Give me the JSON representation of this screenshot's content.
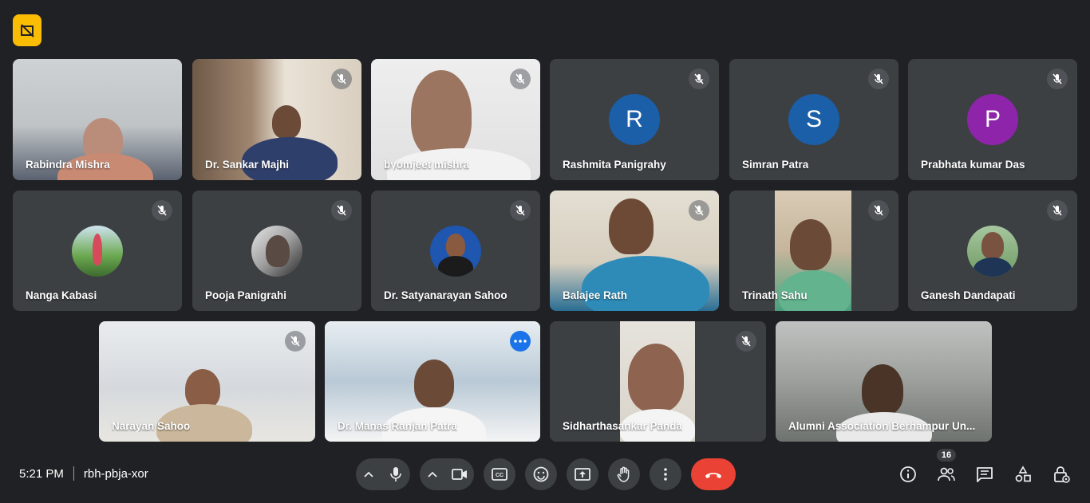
{
  "meeting": {
    "time": "5:21 PM",
    "code": "rbh-pbja-xor",
    "participant_count": "16"
  },
  "colors": {
    "bg": "#202124",
    "tile": "#3c4043",
    "accent": "#8ab4f8",
    "end_call": "#ea4335",
    "record": "#fbbc04"
  },
  "participants": [
    {
      "name": "Rabindra Mishra",
      "muted": false
    },
    {
      "name": "Dr. Sankar Majhi",
      "muted": true
    },
    {
      "name": "byomjeet mishra",
      "muted": true
    },
    {
      "name": "Rashmita Panigrahy",
      "muted": true,
      "initial": "R",
      "avatar_color": "#1a5fa8"
    },
    {
      "name": "Simran Patra",
      "muted": true,
      "initial": "S",
      "avatar_color": "#1a5fa8"
    },
    {
      "name": "Prabhata kumar Das",
      "muted": true,
      "initial": "P",
      "avatar_color": "#8e24aa"
    },
    {
      "name": "Nanga Kabasi",
      "muted": true
    },
    {
      "name": "Pooja Panigrahi",
      "muted": true
    },
    {
      "name": "Dr. Satyanarayan Sahoo",
      "muted": true
    },
    {
      "name": "Balajee Rath",
      "muted": true
    },
    {
      "name": "Trinath Sahu",
      "muted": true
    },
    {
      "name": "Ganesh Dandapati",
      "muted": true
    },
    {
      "name": "Narayan Sahoo",
      "muted": true
    },
    {
      "name": "Dr. Manas Ranjan Patra",
      "muted": false,
      "active": true
    },
    {
      "name": "Sidharthasankar Panda",
      "muted": true
    },
    {
      "name": "Alumni Association Berhampur Un...",
      "muted": false
    }
  ],
  "icons": {
    "record": "recording-icon",
    "mic": "microphone-icon",
    "cam": "camera-icon",
    "cc": "captions-icon",
    "emoji": "emoji-icon",
    "present": "present-screen-icon",
    "hand": "raise-hand-icon",
    "more": "more-options-icon",
    "end": "end-call-icon",
    "info": "info-icon",
    "people": "people-icon",
    "chat": "chat-icon",
    "activities": "activities-icon",
    "host": "host-controls-icon"
  }
}
